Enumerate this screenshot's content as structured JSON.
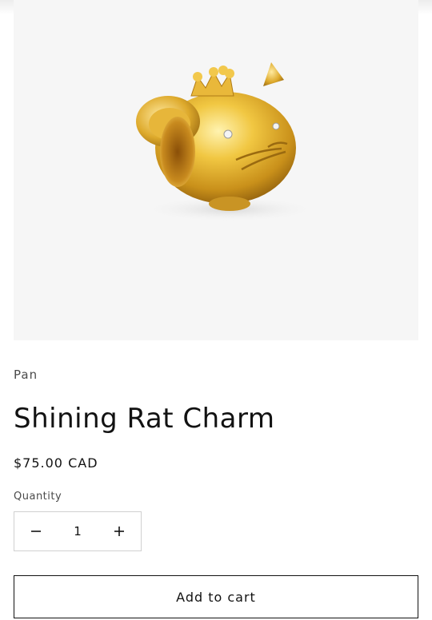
{
  "product": {
    "vendor": "Pan",
    "title": "Shining Rat Charm",
    "price": "$75.00 CAD",
    "image_subject": "gold rat charm with crown"
  },
  "quantity": {
    "label": "Quantity",
    "value": "1",
    "decrease_icon": "minus-icon",
    "increase_icon": "plus-icon"
  },
  "cart": {
    "add_label": "Add to cart"
  },
  "colors": {
    "text": "#121212",
    "muted": "#4a4a4a",
    "image_bg": "#f6f6f6",
    "gold": "#d9a521"
  }
}
